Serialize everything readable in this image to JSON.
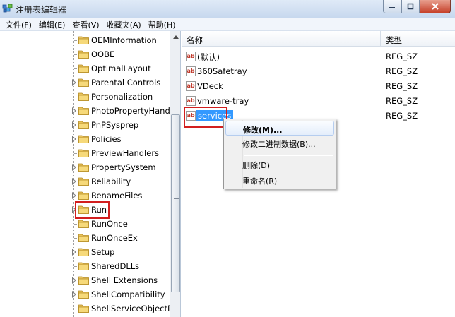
{
  "window": {
    "title": "注册表编辑器"
  },
  "menu": [
    {
      "label": "文件(F)"
    },
    {
      "label": "编辑(E)"
    },
    {
      "label": "查看(V)"
    },
    {
      "label": "收藏夹(A)"
    },
    {
      "label": "帮助(H)"
    }
  ],
  "tree": {
    "items": [
      {
        "label": "OEMInformation",
        "expandable": false
      },
      {
        "label": "OOBE",
        "expandable": false
      },
      {
        "label": "OptimalLayout",
        "expandable": false
      },
      {
        "label": "Parental Controls",
        "expandable": true
      },
      {
        "label": "Personalization",
        "expandable": false
      },
      {
        "label": "PhotoPropertyHandler",
        "expandable": true
      },
      {
        "label": "PnPSysprep",
        "expandable": true
      },
      {
        "label": "Policies",
        "expandable": true
      },
      {
        "label": "PreviewHandlers",
        "expandable": false
      },
      {
        "label": "PropertySystem",
        "expandable": true
      },
      {
        "label": "Reliability",
        "expandable": true
      },
      {
        "label": "RenameFiles",
        "expandable": true
      },
      {
        "label": "Run",
        "expandable": true
      },
      {
        "label": "RunOnce",
        "expandable": false
      },
      {
        "label": "RunOnceEx",
        "expandable": false
      },
      {
        "label": "Setup",
        "expandable": true
      },
      {
        "label": "SharedDLLs",
        "expandable": false
      },
      {
        "label": "Shell Extensions",
        "expandable": true
      },
      {
        "label": "ShellCompatibility",
        "expandable": true
      },
      {
        "label": "ShellServiceObjectDelay",
        "expandable": false
      }
    ]
  },
  "list": {
    "col_name": "名称",
    "col_type": "类型",
    "rows": [
      {
        "name": "(默认)",
        "type": "REG_SZ"
      },
      {
        "name": "360Safetray",
        "type": "REG_SZ"
      },
      {
        "name": "VDeck",
        "type": "REG_SZ"
      },
      {
        "name": "vmware-tray",
        "type": "REG_SZ"
      },
      {
        "name": "services",
        "type": "REG_SZ"
      }
    ],
    "icon_text": "ab"
  },
  "context_menu": {
    "modify": "修改(M)...",
    "modify_binary": "修改二进制数据(B)...",
    "delete": "删除(D)",
    "rename": "重命名(R)"
  },
  "colors": {
    "selection": "#3399ff",
    "annotation": "#d21f1f"
  }
}
